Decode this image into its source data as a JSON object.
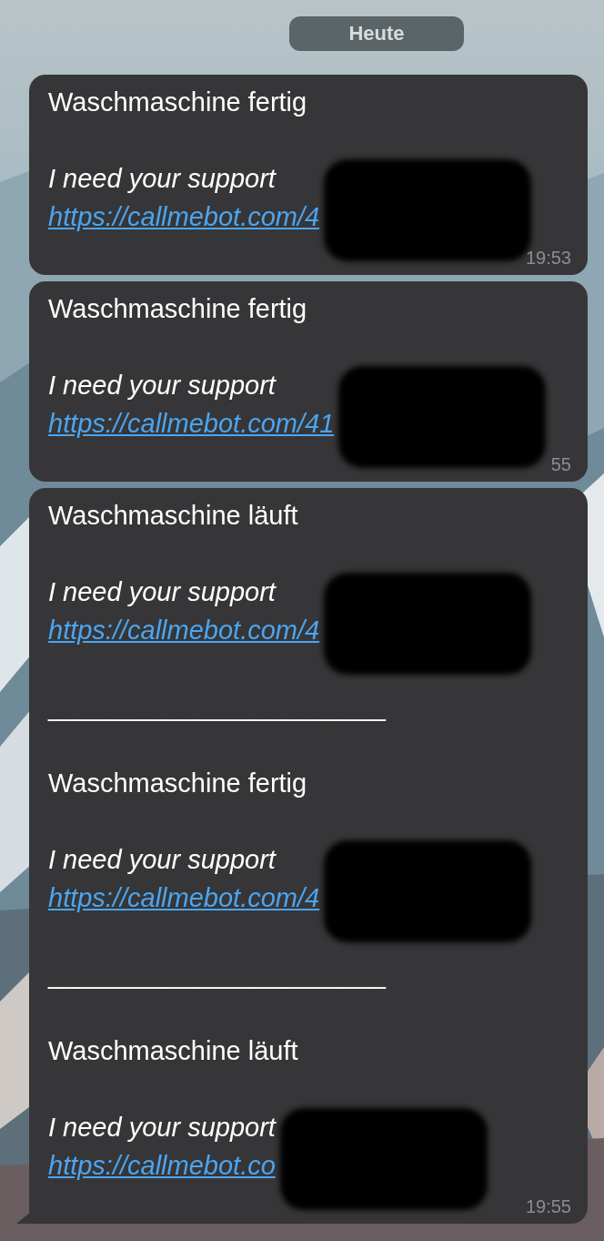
{
  "date_chip": "Heute",
  "messages": [
    {
      "tail": false,
      "time": "19:53",
      "items": [
        {
          "kind": "entry",
          "title": "Waschmaschine fertig",
          "note": "I need your support",
          "link": "https://callmebot.com/4",
          "redacted": true
        }
      ]
    },
    {
      "tail": false,
      "time": "55",
      "items": [
        {
          "kind": "entry",
          "title": "Waschmaschine fertig",
          "note": "I need your support",
          "link": "https://callmebot.com/41",
          "redacted": true
        }
      ]
    },
    {
      "tail": true,
      "time": "19:55",
      "items": [
        {
          "kind": "entry",
          "title": "Waschmaschine läuft",
          "note": "I need your support",
          "link": "https://callmebot.com/4",
          "redacted": true
        },
        {
          "kind": "rule",
          "text": " _______________________"
        },
        {
          "kind": "entry",
          "title": "Waschmaschine fertig",
          "note": "I need your support",
          "link": "https://callmebot.com/4",
          "redacted": true
        },
        {
          "kind": "rule",
          "text": " _______________________"
        },
        {
          "kind": "entry",
          "title": "Waschmaschine läuft",
          "note": "I need your support",
          "link": "https://callmebot.co",
          "redacted": true
        }
      ]
    }
  ]
}
